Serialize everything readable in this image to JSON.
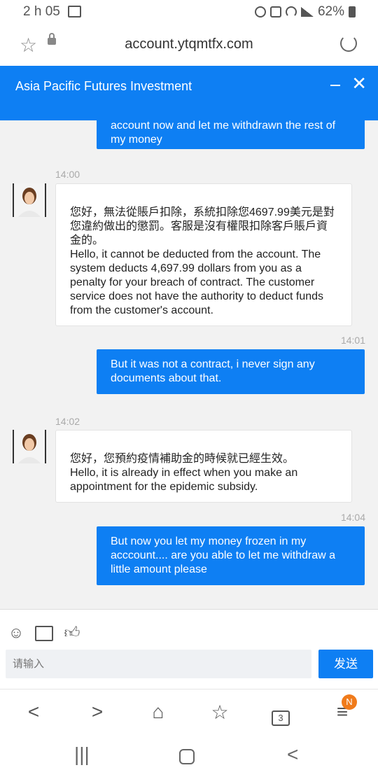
{
  "status_bar": {
    "time": "2 h 05",
    "battery": "62%"
  },
  "browser": {
    "url": "account.ytqmtfx.com"
  },
  "chat_header": {
    "title": "Asia Pacific Futures Investment"
  },
  "messages": [
    {
      "dir": "out",
      "text": "account now and let me withdrawn the rest of my money"
    },
    {
      "dir": "in",
      "time": "14:00",
      "text": "您好，無法從賬戶扣除，系統扣除您4697.99美元是對您違約做出的懲罰。客服是沒有權限扣除客戶賬戶資金的。\nHello, it cannot be deducted from the account. The system deducts 4,697.99 dollars from you as a penalty for your breach of contract. The customer service does not have the authority to deduct funds from the customer's account."
    },
    {
      "dir": "out",
      "time": "14:01",
      "text": "But it was not a contract, i never sign any documents about that."
    },
    {
      "dir": "in",
      "time": "14:02",
      "text": "您好，您預約疫情補助金的時候就已經生效。\nHello, it is already in effect when you make an appointment for the epidemic subsidy."
    },
    {
      "dir": "out",
      "time": "14:04",
      "text": "But now you let my money frozen in my acccount.... are you able to let me withdraw a little amount please"
    }
  ],
  "composer": {
    "placeholder": "请输入",
    "send_label": "发送"
  },
  "bottom_nav": {
    "tabs_count": "3",
    "menu_badge": "N"
  },
  "colors": {
    "accent": "#0e7ff3",
    "badge": "#f07b1b"
  }
}
